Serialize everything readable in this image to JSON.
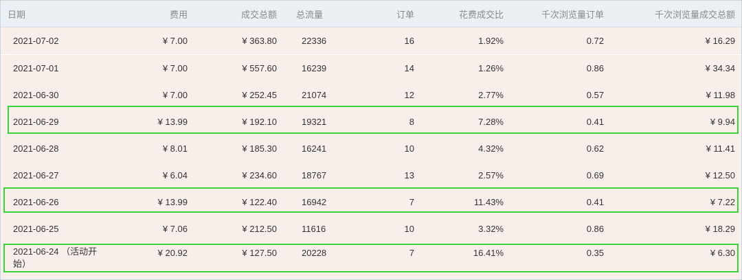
{
  "columns": [
    "日期",
    "费用",
    "成交总额",
    "总流量",
    "订单",
    "花费成交比",
    "千次浏览量订单",
    "千次浏览量成交总额"
  ],
  "rows": [
    [
      "2021-07-02",
      "¥ 7.00",
      "¥ 363.80",
      "22336",
      "16",
      "1.92%",
      "0.72",
      "¥ 16.29"
    ],
    [
      "2021-07-01",
      "¥ 7.00",
      "¥ 557.60",
      "16239",
      "14",
      "1.26%",
      "0.86",
      "¥ 34.34"
    ],
    [
      "2021-06-30",
      "¥ 7.00",
      "¥ 252.45",
      "21074",
      "12",
      "2.77%",
      "0.57",
      "¥ 11.98"
    ],
    [
      "2021-06-29",
      "¥ 13.99",
      "¥ 192.10",
      "19321",
      "8",
      "7.28%",
      "0.41",
      "¥ 9.94"
    ],
    [
      "2021-06-28",
      "¥ 8.01",
      "¥ 185.30",
      "16241",
      "10",
      "4.32%",
      "0.62",
      "¥ 11.41"
    ],
    [
      "2021-06-27",
      "¥ 6.04",
      "¥ 234.60",
      "18767",
      "13",
      "2.57%",
      "0.69",
      "¥ 12.50"
    ],
    [
      "2021-06-26",
      "¥ 13.99",
      "¥ 122.40",
      "16942",
      "7",
      "11.43%",
      "0.41",
      "¥ 7.22"
    ],
    [
      "2021-06-25",
      "¥ 7.06",
      "¥ 212.50",
      "11616",
      "10",
      "3.32%",
      "0.86",
      "¥ 18.29"
    ],
    [
      "2021-06-24 （活动开始）",
      "¥ 20.92",
      "¥ 127.50",
      "20228",
      "7",
      "16.41%",
      "0.35",
      "¥ 6.30"
    ]
  ],
  "highlight_color": "#39d43a",
  "header_bg": "#eaf0f3",
  "row_bg": "#f8efea"
}
